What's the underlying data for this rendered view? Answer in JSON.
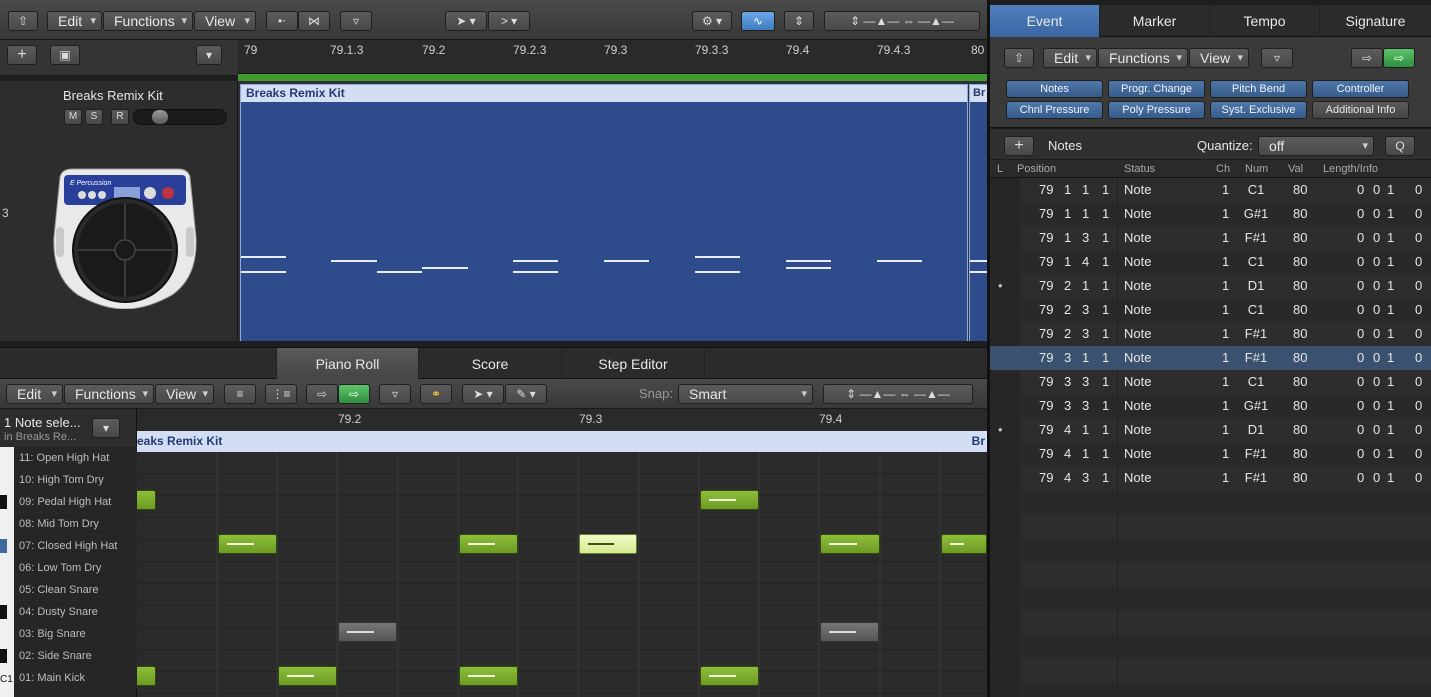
{
  "arrange": {
    "menus": {
      "edit": "Edit",
      "functions": "Functions",
      "view": "View"
    },
    "ruler": [
      "79",
      "79.1.3",
      "79.2",
      "79.2.3",
      "79.3",
      "79.3.3",
      "79.4",
      "79.4.3",
      "80"
    ],
    "track": {
      "name": "Breaks Remix Kit",
      "number": "3",
      "m": "M",
      "s": "S",
      "r": "R",
      "instrument_label": "E Percussion"
    },
    "region": {
      "name": "Breaks Remix Kit",
      "next_name": "Br"
    }
  },
  "editor_tabs": [
    "Piano Roll",
    "Score",
    "Step Editor"
  ],
  "pianoroll": {
    "menus": {
      "edit": "Edit",
      "functions": "Functions",
      "view": "View"
    },
    "snap_label": "Snap:",
    "snap_value": "Smart",
    "ruler": [
      "79.2",
      "79.3",
      "79.4"
    ],
    "selection": {
      "title": "1 Note sele...",
      "subtitle": "in Breaks Re..."
    },
    "region": {
      "name": "eaks Remix Kit",
      "next_name": "Br"
    },
    "keys": [
      "11: Open High Hat",
      "10: High Tom Dry",
      "09: Pedal High Hat",
      "08: Mid Tom Dry",
      "07: Closed High Hat",
      "06: Low Tom Dry",
      "05: Clean Snare",
      "04: Dusty Snare",
      "03: Big Snare",
      "02: Side Snare",
      "01: Main Kick"
    ],
    "c1_label": "C1"
  },
  "event_list": {
    "tabs": [
      "Event",
      "Marker",
      "Tempo",
      "Signature"
    ],
    "menus": {
      "edit": "Edit",
      "functions": "Functions",
      "view": "View"
    },
    "filters": [
      "Notes",
      "Progr. Change",
      "Pitch Bend",
      "Controller",
      "Chnl Pressure",
      "Poly Pressure",
      "Syst. Exclusive",
      "Additional Info"
    ],
    "create_label": "Notes",
    "quantize_label": "Quantize:",
    "quantize_value": "off",
    "q_button": "Q",
    "columns": [
      "L",
      "Position",
      "Status",
      "Ch",
      "Num",
      "Val",
      "Length/Info"
    ],
    "rows": [
      {
        "pos": [
          "79",
          "1",
          "1",
          "1"
        ],
        "status": "Note",
        "ch": "1",
        "num": "C1",
        "val": "80",
        "len": [
          "0",
          "0",
          "1",
          "0"
        ],
        "dot": ""
      },
      {
        "pos": [
          "79",
          "1",
          "1",
          "1"
        ],
        "status": "Note",
        "ch": "1",
        "num": "G#1",
        "val": "80",
        "len": [
          "0",
          "0",
          "1",
          "0"
        ],
        "dot": ""
      },
      {
        "pos": [
          "79",
          "1",
          "3",
          "1"
        ],
        "status": "Note",
        "ch": "1",
        "num": "F#1",
        "val": "80",
        "len": [
          "0",
          "0",
          "1",
          "0"
        ],
        "dot": ""
      },
      {
        "pos": [
          "79",
          "1",
          "4",
          "1"
        ],
        "status": "Note",
        "ch": "1",
        "num": "C1",
        "val": "80",
        "len": [
          "0",
          "0",
          "1",
          "0"
        ],
        "dot": ""
      },
      {
        "pos": [
          "79",
          "2",
          "1",
          "1"
        ],
        "status": "Note",
        "ch": "1",
        "num": "D1",
        "val": "80",
        "len": [
          "0",
          "0",
          "1",
          "0"
        ],
        "dot": "•"
      },
      {
        "pos": [
          "79",
          "2",
          "3",
          "1"
        ],
        "status": "Note",
        "ch": "1",
        "num": "C1",
        "val": "80",
        "len": [
          "0",
          "0",
          "1",
          "0"
        ],
        "dot": ""
      },
      {
        "pos": [
          "79",
          "2",
          "3",
          "1"
        ],
        "status": "Note",
        "ch": "1",
        "num": "F#1",
        "val": "80",
        "len": [
          "0",
          "0",
          "1",
          "0"
        ],
        "dot": ""
      },
      {
        "pos": [
          "79",
          "3",
          "1",
          "1"
        ],
        "status": "Note",
        "ch": "1",
        "num": "F#1",
        "val": "80",
        "len": [
          "0",
          "0",
          "1",
          "0"
        ],
        "dot": ""
      },
      {
        "pos": [
          "79",
          "3",
          "3",
          "1"
        ],
        "status": "Note",
        "ch": "1",
        "num": "C1",
        "val": "80",
        "len": [
          "0",
          "0",
          "1",
          "0"
        ],
        "dot": ""
      },
      {
        "pos": [
          "79",
          "3",
          "3",
          "1"
        ],
        "status": "Note",
        "ch": "1",
        "num": "G#1",
        "val": "80",
        "len": [
          "0",
          "0",
          "1",
          "0"
        ],
        "dot": ""
      },
      {
        "pos": [
          "79",
          "4",
          "1",
          "1"
        ],
        "status": "Note",
        "ch": "1",
        "num": "D1",
        "val": "80",
        "len": [
          "0",
          "0",
          "1",
          "0"
        ],
        "dot": "•"
      },
      {
        "pos": [
          "79",
          "4",
          "1",
          "1"
        ],
        "status": "Note",
        "ch": "1",
        "num": "F#1",
        "val": "80",
        "len": [
          "0",
          "0",
          "1",
          "0"
        ],
        "dot": ""
      },
      {
        "pos": [
          "79",
          "4",
          "3",
          "1"
        ],
        "status": "Note",
        "ch": "1",
        "num": "F#1",
        "val": "80",
        "len": [
          "0",
          "0",
          "1",
          "0"
        ],
        "dot": ""
      }
    ],
    "selected_row": 7
  },
  "colors": {
    "region_blue": "#2e4b8c",
    "note_green": "#7aab2e",
    "selected_row": "#3a5170",
    "accent_blue": "#3f6aa0"
  }
}
